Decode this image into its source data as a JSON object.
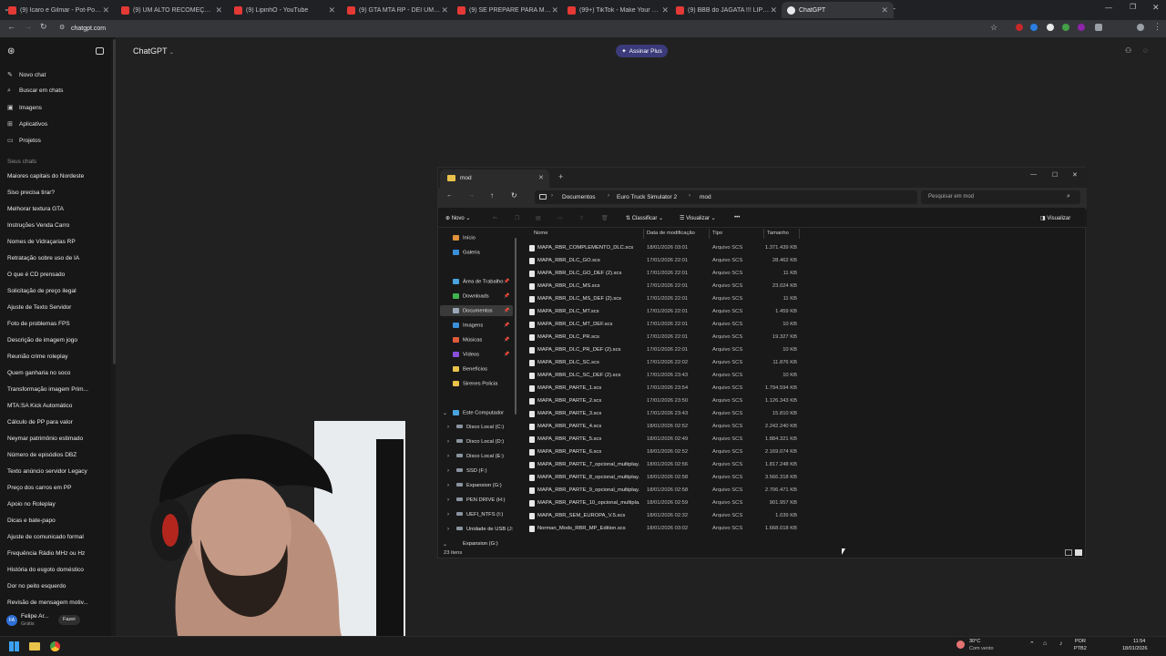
{
  "browser": {
    "tabs": [
      {
        "label": "(9) Ícaro e Gilmar - Pot-Pourri..."
      },
      {
        "label": "(9) UM ALTO RECOMEÇO! 💜..."
      },
      {
        "label": "(9) LipinhO - YouTube"
      },
      {
        "label": "(9) GTA MTA RP - DEI UM TAPA..."
      },
      {
        "label": "(9) SE PREPARE PARA MUITA C..."
      },
      {
        "label": "(99+) TikTok - Make Your Day"
      },
      {
        "label": "(9) BBB do JAGATA !!! LIPINHO..."
      },
      {
        "label": "ChatGPT"
      }
    ],
    "url": "chatgpt.com"
  },
  "chatgpt": {
    "header_title": "ChatGPT",
    "plus_button": "Assinar Plus",
    "nav": [
      {
        "label": "Novo chat",
        "icon": "edit-icon"
      },
      {
        "label": "Buscar em chats",
        "icon": "search-icon"
      },
      {
        "label": "Imagens",
        "icon": "image-icon"
      },
      {
        "label": "Aplicativos",
        "icon": "apps-icon"
      },
      {
        "label": "Projetos",
        "icon": "folder-icon"
      }
    ],
    "chats_heading": "Seus chats",
    "chats": [
      "Maiores capitais do Nordeste",
      "Siso precisa tirar?",
      "Melhorar textura GTA",
      "Instruções Venda Carro",
      "Nomes de Vidraçarias RP",
      "Retratação sobre uso de IA",
      "O que é CD prensado",
      "Solicitação de preço ilegal",
      "Ajuste de Texto Servidor",
      "Foto de problemas FPS",
      "Descrição de imagem jogo",
      "Reunião crime roleplay",
      "Quem ganharia no soco",
      "Transformação imagem Prim...",
      "MTA:SA Kick Automático",
      "Cálculo de PP para valor",
      "Neymar patrimônio estimado",
      "Número de episódios DBZ",
      "Texto anúncio servidor Legacy",
      "Preço dos carros em PP",
      "Apoio no Roleplay",
      "Dicas e bate-papo",
      "Ajuste de comunicado formal",
      "Frequência Rádio MHz ou Hz",
      "História do esgoto doméstico",
      "Dor no peito esquerdo",
      "Revisão de mensagem motiv..."
    ],
    "user": {
      "name": "Felipe Ar...",
      "plan": "Grátis",
      "initials": "FA",
      "upgrade": "Fazer"
    }
  },
  "explorer": {
    "tab_title": "mod",
    "breadcrumb": [
      "Documentos",
      "Euro Truck Simulator 2",
      "mod"
    ],
    "search_placeholder": "Pesquisar em mod",
    "toolbar": {
      "new": "Novo",
      "sort": "Classificar",
      "view": "Visualizar",
      "details": "Visualizar"
    },
    "nav_pane": [
      {
        "label": "Início",
        "color": "#e0913a"
      },
      {
        "label": "Galeria",
        "color": "#3a8fd9"
      },
      {
        "label": "Área de Trabalho",
        "color": "#4aa3df",
        "pin": true
      },
      {
        "label": "Downloads",
        "color": "#3fb34f",
        "pin": true
      },
      {
        "label": "Documentos",
        "color": "#9aa7b8",
        "pin": true,
        "selected": true
      },
      {
        "label": "Imagens",
        "color": "#3a8fd9",
        "pin": true
      },
      {
        "label": "Músicas",
        "color": "#e05a3a",
        "pin": true
      },
      {
        "label": "Vídeos",
        "color": "#8a4fd9",
        "pin": true
      },
      {
        "label": "Benefícios",
        "color": "#e8c24a"
      },
      {
        "label": "Sirenes Policia",
        "color": "#e8c24a"
      }
    ],
    "computer": {
      "label": "Este Computador",
      "drives": [
        "Disco Local (C:)",
        "Disco Local (D:)",
        "Disco Local (E:)",
        "SSD (F:)",
        "Expansion (G:)",
        "PEN DRIVE (H:)",
        "UEFI_NTFS (I:)",
        "Unidade de USB (J:"
      ],
      "last": "Expansion (G:)"
    },
    "columns": {
      "name": "Nome",
      "date": "Data de modificação",
      "type": "Tipo",
      "size": "Tamanho"
    },
    "files": [
      {
        "name": "MAPA_RBR_COMPLEMENTO_DLC.scs",
        "date": "18/01/2026 03:01",
        "type": "Arquivo SCS",
        "size": "1.371.439 KB"
      },
      {
        "name": "MAPA_RBR_DLC_GO.scs",
        "date": "17/01/2026 22:01",
        "type": "Arquivo SCS",
        "size": "28.462 KB"
      },
      {
        "name": "MAPA_RBR_DLC_GO_DEF (2).scs",
        "date": "17/01/2026 22:01",
        "type": "Arquivo SCS",
        "size": "11 KB"
      },
      {
        "name": "MAPA_RBR_DLC_MS.scs",
        "date": "17/01/2026 22:01",
        "type": "Arquivo SCS",
        "size": "23.024 KB"
      },
      {
        "name": "MAPA_RBR_DLC_MS_DEF (2).scs",
        "date": "17/01/2026 22:01",
        "type": "Arquivo SCS",
        "size": "11 KB"
      },
      {
        "name": "MAPA_RBR_DLC_MT.scs",
        "date": "17/01/2026 22:01",
        "type": "Arquivo SCS",
        "size": "1.459 KB"
      },
      {
        "name": "MAPA_RBR_DLC_MT_DEF.scs",
        "date": "17/01/2026 22:01",
        "type": "Arquivo SCS",
        "size": "10 KB"
      },
      {
        "name": "MAPA_RBR_DLC_PR.scs",
        "date": "17/01/2026 22:01",
        "type": "Arquivo SCS",
        "size": "19.327 KB"
      },
      {
        "name": "MAPA_RBR_DLC_PR_DEF (2).scs",
        "date": "17/01/2026 22:01",
        "type": "Arquivo SCS",
        "size": "10 KB"
      },
      {
        "name": "MAPA_RBR_DLC_SC.scs",
        "date": "17/01/2026 22:02",
        "type": "Arquivo SCS",
        "size": "11.876 KB"
      },
      {
        "name": "MAPA_RBR_DLC_SC_DEF (2).scs",
        "date": "17/01/2026 23:43",
        "type": "Arquivo SCS",
        "size": "10 KB"
      },
      {
        "name": "MAPA_RBR_PARTE_1.scs",
        "date": "17/01/2026 23:54",
        "type": "Arquivo SCS",
        "size": "1.794.594 KB"
      },
      {
        "name": "MAPA_RBR_PARTE_2.scs",
        "date": "17/01/2026 23:50",
        "type": "Arquivo SCS",
        "size": "1.126.343 KB"
      },
      {
        "name": "MAPA_RBR_PARTE_3.scs",
        "date": "17/01/2026 23:43",
        "type": "Arquivo SCS",
        "size": "15.810 KB"
      },
      {
        "name": "MAPA_RBR_PARTE_4.scs",
        "date": "18/01/2026 02:52",
        "type": "Arquivo SCS",
        "size": "2.242.240 KB"
      },
      {
        "name": "MAPA_RBR_PARTE_5.scs",
        "date": "18/01/2026 02:49",
        "type": "Arquivo SCS",
        "size": "1.884.321 KB"
      },
      {
        "name": "MAPA_RBR_PARTE_6.scs",
        "date": "18/01/2026 02:52",
        "type": "Arquivo SCS",
        "size": "2.169.074 KB"
      },
      {
        "name": "MAPA_RBR_PARTE_7_opcional_multiplay...",
        "date": "18/01/2026 02:56",
        "type": "Arquivo SCS",
        "size": "1.817.248 KB"
      },
      {
        "name": "MAPA_RBR_PARTE_8_opcional_multiplay...",
        "date": "18/01/2026 02:58",
        "type": "Arquivo SCS",
        "size": "3.566.318 KB"
      },
      {
        "name": "MAPA_RBR_PARTE_9_opcional_multiplay...",
        "date": "18/01/2026 02:58",
        "type": "Arquivo SCS",
        "size": "2.706.471 KB"
      },
      {
        "name": "MAPA_RBR_PARTE_10_opcional_multipla...",
        "date": "18/01/2026 02:59",
        "type": "Arquivo SCS",
        "size": "901.957 KB"
      },
      {
        "name": "MAPA_RBR_SEM_EUROPA_V.5.scs",
        "date": "18/01/2026 02:32",
        "type": "Arquivo SCS",
        "size": "1.039 KB"
      },
      {
        "name": "Norman_Mods_RBR_MP_Edition.scs",
        "date": "18/01/2026 03:02",
        "type": "Arquivo SCS",
        "size": "1.668.018 KB"
      }
    ],
    "status": "23 itens"
  },
  "taskbar": {
    "weather_temp": "30°C",
    "weather_desc": "Com vento",
    "lang": "POR",
    "lang2": "PTB2",
    "time": "11:54",
    "date": "18/01/2026"
  }
}
